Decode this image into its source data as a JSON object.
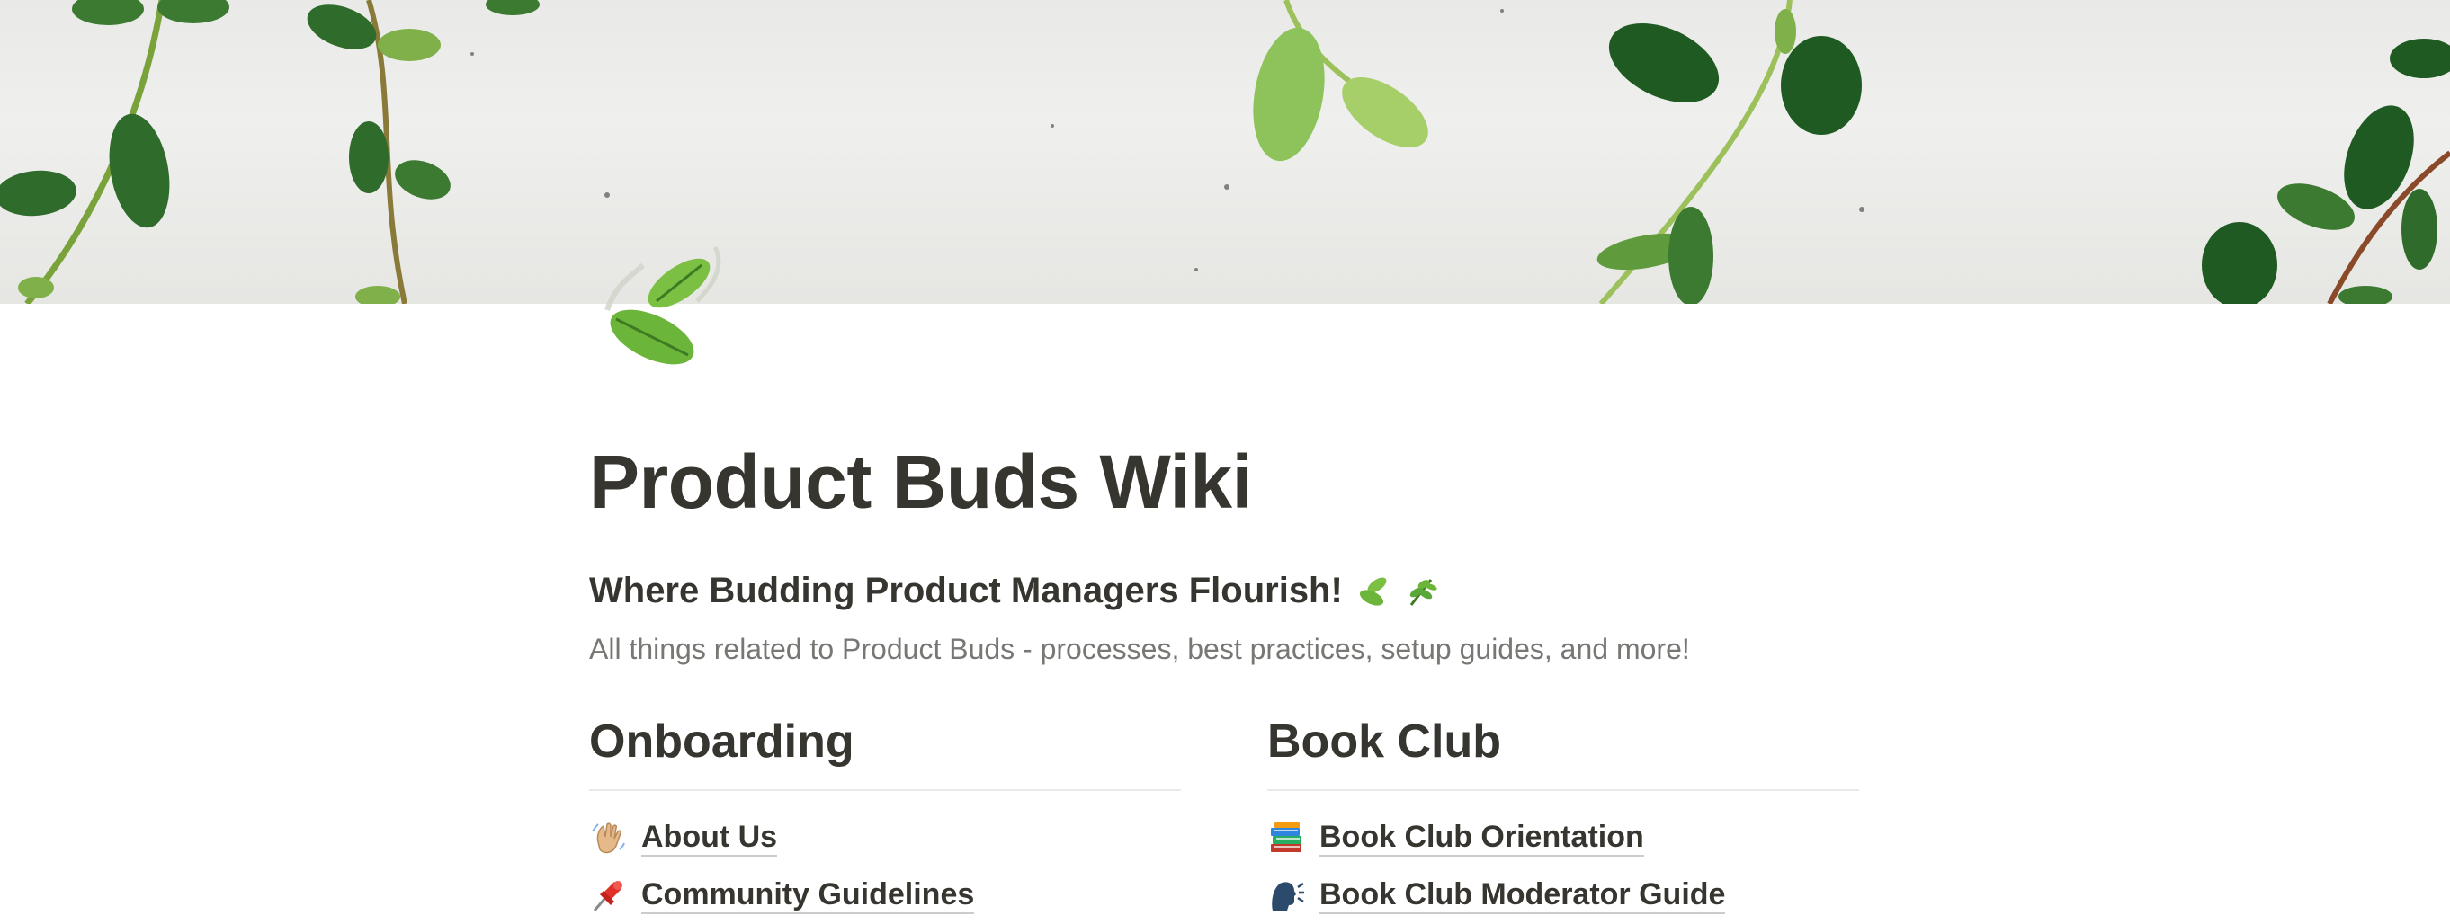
{
  "page": {
    "title": "Product Buds Wiki",
    "subtitle": "Where Budding Product Managers Flourish!",
    "description": "All things related to Product Buds - processes, best practices, setup guides, and more!"
  },
  "icons": {
    "page_icon": "leaves-icon",
    "subtitle_emojis": [
      "leaves-icon",
      "herb-icon"
    ]
  },
  "sections": {
    "onboarding": {
      "heading": "Onboarding",
      "items": [
        {
          "label": "About Us",
          "icon": "waving-hand-icon"
        },
        {
          "label": "Community Guidelines",
          "icon": "pushpin-icon"
        }
      ]
    },
    "book_club": {
      "heading": "Book Club",
      "items": [
        {
          "label": "Book Club Orientation",
          "icon": "books-icon"
        },
        {
          "label": "Book Club Moderator Guide",
          "icon": "speaking-head-icon"
        }
      ]
    }
  },
  "colors": {
    "text": "#37352f",
    "muted": "#787774",
    "divider": "#e9e9e7",
    "leaf": "#6db33f",
    "cover": "#ececea"
  }
}
